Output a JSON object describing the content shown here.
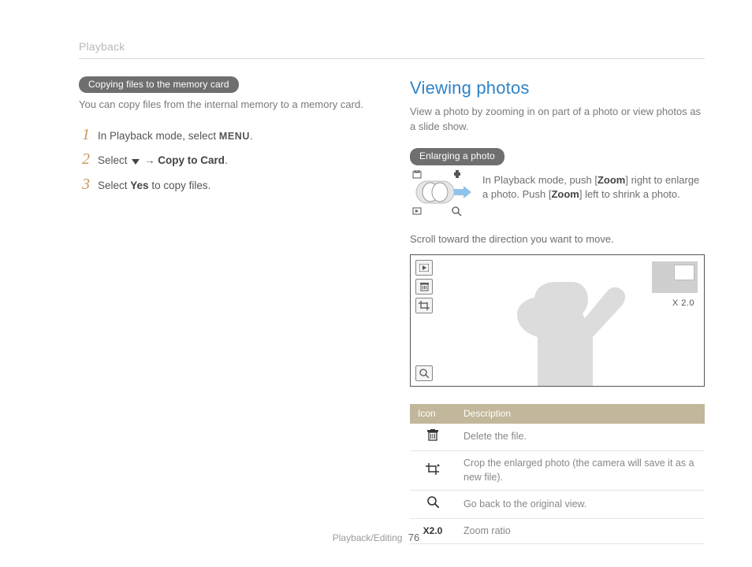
{
  "header": {
    "breadcrumb": "Playback"
  },
  "left": {
    "pill": "Copying files to the memory card",
    "lead": "You can copy files from the internal memory to a memory card.",
    "steps": [
      {
        "n": "1",
        "pre": "In Playback mode, select ",
        "menu": "MENU",
        "post": "."
      },
      {
        "n": "2",
        "pre": "Select ",
        "arrow": true,
        "bold": "Copy to Card",
        "post": "."
      },
      {
        "n": "3",
        "pre": "Select ",
        "bold": "Yes",
        "post": " to copy files."
      }
    ]
  },
  "right": {
    "title": "Viewing photos",
    "lead": "View a photo by zooming in on part of a photo or view photos as a slide show.",
    "pill": "Enlarging a photo",
    "zoom_text": {
      "l1a": "In Playback mode, push [",
      "l1b": "Zoom",
      "l1c": "] right to enlarge a photo. Push [",
      "l1d": "Zoom",
      "l1e": "] left to shrink a photo."
    },
    "scroll_note": "Scroll toward the direction you want to move.",
    "viewer": {
      "ratio": "X 2.0"
    },
    "table": {
      "headers": [
        "Icon",
        "Description"
      ],
      "rows": [
        {
          "icon": "trash",
          "label": "",
          "desc": "Delete the file."
        },
        {
          "icon": "crop",
          "label": "",
          "desc": "Crop the enlarged photo (the camera will save it as a new file)."
        },
        {
          "icon": "mag",
          "label": "",
          "desc": "Go back to the original view."
        },
        {
          "icon": "text",
          "label": "X2.0",
          "desc": "Zoom ratio"
        }
      ]
    }
  },
  "footer": {
    "section": "Playback/Editing",
    "page": "76"
  }
}
